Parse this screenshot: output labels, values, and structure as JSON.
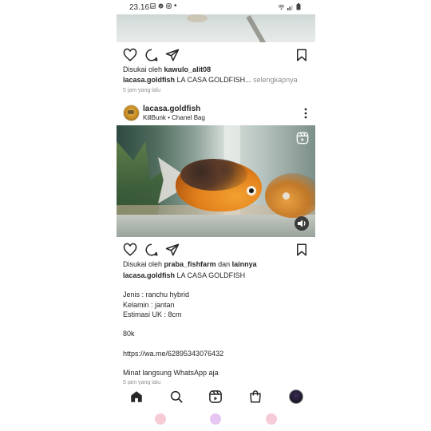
{
  "status_bar": {
    "time": "23.16"
  },
  "prev_post": {
    "liked_by_prefix": "Disukai oleh",
    "liked_by_user": "kawulo_alit08",
    "caption_user": "lacasa.goldfish",
    "caption_text": "LA CASA GOLDFISH...",
    "more_label": "selengkapnya",
    "timestamp": "5 jam yang lalu"
  },
  "post": {
    "username": "lacasa.goldfish",
    "subtitle": "KillBunk • Chanel Bag",
    "liked_by_prefix": "Disukai oleh",
    "liked_by_user": "praba_fishfarm",
    "liked_by_conj": "dan",
    "liked_by_others": "lainnya",
    "caption_user": "lacasa.goldfish",
    "caption_title": "LA CASA GOLDFISH",
    "caption_lines": [
      "Jenis : ranchu hybrid",
      "Kelamin :  jantan",
      "Estimasi UK : 8cm",
      "80k",
      " https://wa.me/62895343076432",
      "Minat langsung WhatsApp aja"
    ],
    "timestamp": "5 jam yang lalu"
  },
  "icons": {
    "like": "heart-icon",
    "comment": "comment-icon",
    "share": "send-icon",
    "save": "bookmark-icon",
    "more": "more-vertical-icon",
    "reels_badge": "reels-icon",
    "audio": "speaker-icon"
  },
  "nav": {
    "items": [
      "home-icon",
      "search-icon",
      "reels-icon",
      "shop-icon",
      "profile-avatar"
    ]
  }
}
